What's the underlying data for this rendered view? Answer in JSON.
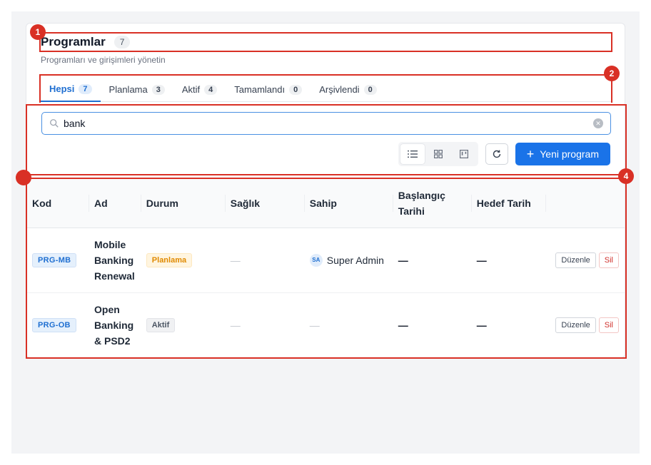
{
  "header": {
    "title": "Programlar",
    "count": "7",
    "subtitle": "Programları ve girişimleri yönetin"
  },
  "tabs": [
    {
      "label": "Hepsi",
      "count": "7",
      "active": true
    },
    {
      "label": "Planlama",
      "count": "3",
      "active": false
    },
    {
      "label": "Aktif",
      "count": "4",
      "active": false
    },
    {
      "label": "Tamamlandı",
      "count": "0",
      "active": false
    },
    {
      "label": "Arşivlendi",
      "count": "0",
      "active": false
    }
  ],
  "search": {
    "value": "bank"
  },
  "toolbar": {
    "new_label": "Yeni program"
  },
  "table": {
    "columns": [
      "Kod",
      "Ad",
      "Durum",
      "Sağlık",
      "Sahip",
      "Başlangıç Tarihi",
      "Hedef Tarih"
    ],
    "rows": [
      {
        "code": "PRG-MB",
        "name": "Mobile Banking Renewal",
        "status": "Planlama",
        "health": "—",
        "owner_initials": "SA",
        "owner": "Super Admin",
        "start": "—",
        "target": "—",
        "edit": "Düzenle",
        "delete": "Sil"
      },
      {
        "code": "PRG-OB",
        "name": "Open Banking & PSD2",
        "status": "Aktif",
        "health": "—",
        "owner": "—",
        "start": "—",
        "target": "—",
        "edit": "Düzenle",
        "delete": "Sil"
      }
    ]
  },
  "annotations": [
    "1",
    "2",
    "4"
  ],
  "colors": {
    "accent": "#1a73e8",
    "annotation": "#d93025"
  }
}
